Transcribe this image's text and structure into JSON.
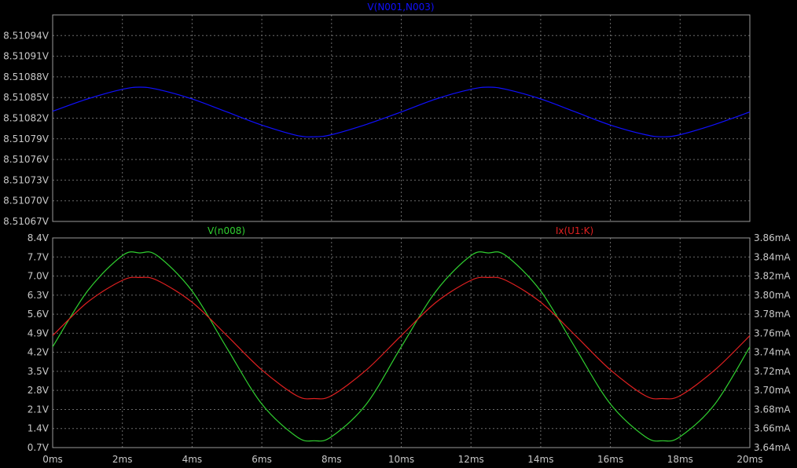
{
  "chart_data": [
    {
      "type": "line",
      "title": "V(N001,N003)",
      "title_color": "#1010ff",
      "xlim": [
        0,
        20
      ],
      "x_tick_labels": [
        "0ms",
        "2ms",
        "4ms",
        "6ms",
        "8ms",
        "10ms",
        "12ms",
        "14ms",
        "16ms",
        "18ms",
        "20ms"
      ],
      "ylim": [
        8.51067,
        8.51097
      ],
      "y_tick_values": [
        8.51067,
        8.5107,
        8.51073,
        8.51076,
        8.51079,
        8.51082,
        8.51085,
        8.51088,
        8.51091,
        8.51094
      ],
      "y_tick_labels": [
        "8.51067V",
        "8.51070V",
        "8.51073V",
        "8.51076V",
        "8.51079V",
        "8.51082V",
        "8.51085V",
        "8.51088V",
        "8.51091V",
        "8.51094V"
      ],
      "grid": true,
      "series": [
        {
          "name": "V(N001,N003)",
          "color": "#1010ff",
          "axis": "left",
          "x": [
            0,
            1,
            2,
            2.5,
            3,
            4,
            5,
            6,
            7,
            7.5,
            8,
            9,
            10,
            11,
            12,
            12.5,
            13,
            14,
            15,
            16,
            17,
            17.5,
            18,
            19,
            20
          ],
          "y": [
            8.51083,
            8.510848,
            8.510862,
            8.510865,
            8.510862,
            8.510848,
            8.510829,
            8.51081,
            8.510795,
            8.510793,
            8.510796,
            8.510811,
            8.510829,
            8.510848,
            8.510862,
            8.510865,
            8.510862,
            8.510848,
            8.510829,
            8.51081,
            8.510796,
            8.510793,
            8.510796,
            8.510811,
            8.510829
          ]
        }
      ]
    },
    {
      "type": "line",
      "title_left": "V(n008)",
      "title_left_color": "#30d030",
      "title_right": "Ix(U1:K)",
      "title_right_color": "#e02020",
      "xlim": [
        0,
        20
      ],
      "x_tick_labels": [
        "0ms",
        "2ms",
        "4ms",
        "6ms",
        "8ms",
        "10ms",
        "12ms",
        "14ms",
        "16ms",
        "18ms",
        "20ms"
      ],
      "ylim_left": [
        0.7,
        8.4
      ],
      "y_left_tick_values": [
        0.7,
        1.4,
        2.1,
        2.8,
        3.5,
        4.2,
        4.9,
        5.6,
        6.3,
        7.0,
        7.7,
        8.4
      ],
      "y_left_tick_labels": [
        "0.7V",
        "1.4V",
        "2.1V",
        "2.8V",
        "3.5V",
        "4.2V",
        "4.9V",
        "5.6V",
        "6.3V",
        "7.0V",
        "7.7V",
        "8.4V"
      ],
      "ylim_right": [
        3.64,
        3.86
      ],
      "y_right_tick_values": [
        3.64,
        3.66,
        3.68,
        3.7,
        3.72,
        3.74,
        3.76,
        3.78,
        3.8,
        3.82,
        3.84,
        3.86
      ],
      "y_right_tick_labels": [
        "3.64mA",
        "3.66mA",
        "3.68mA",
        "3.70mA",
        "3.72mA",
        "3.74mA",
        "3.76mA",
        "3.78mA",
        "3.80mA",
        "3.82mA",
        "3.84mA",
        "3.86mA"
      ],
      "grid": true,
      "series": [
        {
          "name": "V(n008)",
          "color": "#30d030",
          "axis": "left",
          "x": [
            0,
            1,
            2,
            2.5,
            3,
            4,
            5,
            6,
            7,
            7.5,
            8,
            9,
            10,
            11,
            12,
            12.5,
            13,
            14,
            15,
            16,
            17,
            17.5,
            18,
            19,
            20
          ],
          "y": [
            4.4,
            6.45,
            7.75,
            7.85,
            7.75,
            6.45,
            4.35,
            2.3,
            1.1,
            0.95,
            1.1,
            2.3,
            4.4,
            6.45,
            7.75,
            7.85,
            7.75,
            6.45,
            4.35,
            2.3,
            1.1,
            0.95,
            1.1,
            2.3,
            4.4
          ]
        },
        {
          "name": "Ix(U1:K)",
          "color": "#e02020",
          "axis": "right",
          "x": [
            0,
            1,
            2,
            2.5,
            3,
            4,
            5,
            6,
            7,
            7.5,
            8,
            9,
            10,
            11,
            12,
            12.5,
            13,
            14,
            15,
            16,
            17,
            17.5,
            18,
            19,
            20
          ],
          "y": [
            3.7575,
            3.7925,
            3.8155,
            3.8185,
            3.8155,
            3.7925,
            3.7575,
            3.7215,
            3.6945,
            3.6915,
            3.6945,
            3.7215,
            3.7575,
            3.7925,
            3.8155,
            3.8185,
            3.8155,
            3.7925,
            3.7575,
            3.7215,
            3.6945,
            3.6915,
            3.6945,
            3.7215,
            3.7575
          ]
        }
      ]
    }
  ]
}
